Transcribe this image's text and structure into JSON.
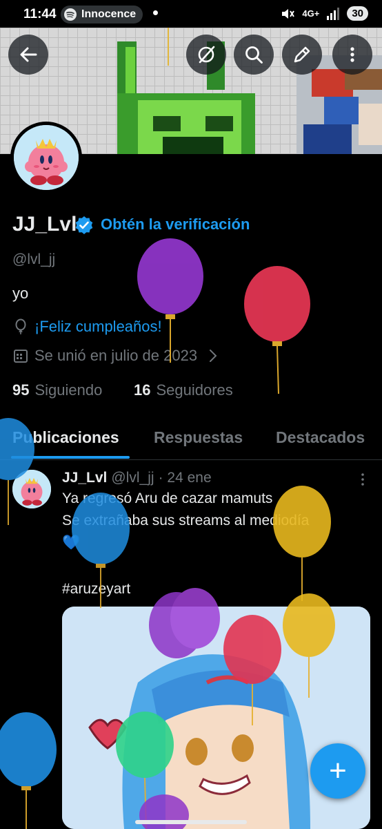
{
  "status_bar": {
    "time": "11:44",
    "media_app": "Innocence",
    "network": "4G+",
    "battery": "30"
  },
  "header": {
    "back_icon": "arrow-left-icon",
    "actions": [
      "grok-icon",
      "search-icon",
      "edit-icon",
      "more-vertical-icon"
    ]
  },
  "profile": {
    "display_name": "JJ_Lvl",
    "verify_cta": "Obtén la verificación",
    "handle": "@lvl_jj",
    "bio": "yo",
    "birthday": "¡Feliz cumpleaños!",
    "joined": "Se unió en julio de 2023",
    "following_count": "95",
    "following_label": "Siguiendo",
    "followers_count": "16",
    "followers_label": "Seguidores"
  },
  "tabs": [
    {
      "label": "Publicaciones",
      "active": true
    },
    {
      "label": "Respuestas",
      "active": false
    },
    {
      "label": "Destacados",
      "active": false
    }
  ],
  "post": {
    "author": "JJ_Lvl",
    "handle": "@lvl_jj",
    "date": "· 24 ene",
    "line1": "Ya regresó Aru de cazar mamuts",
    "line2": "Se extrañaba sus streams al mediodía",
    "emoji": "💙",
    "hashtag": "#aruzeyart"
  },
  "fab_label": "+",
  "colors": {
    "accent": "#1d9bf0",
    "text": "#e7e9ea",
    "muted": "#71767b",
    "background": "#000000"
  }
}
